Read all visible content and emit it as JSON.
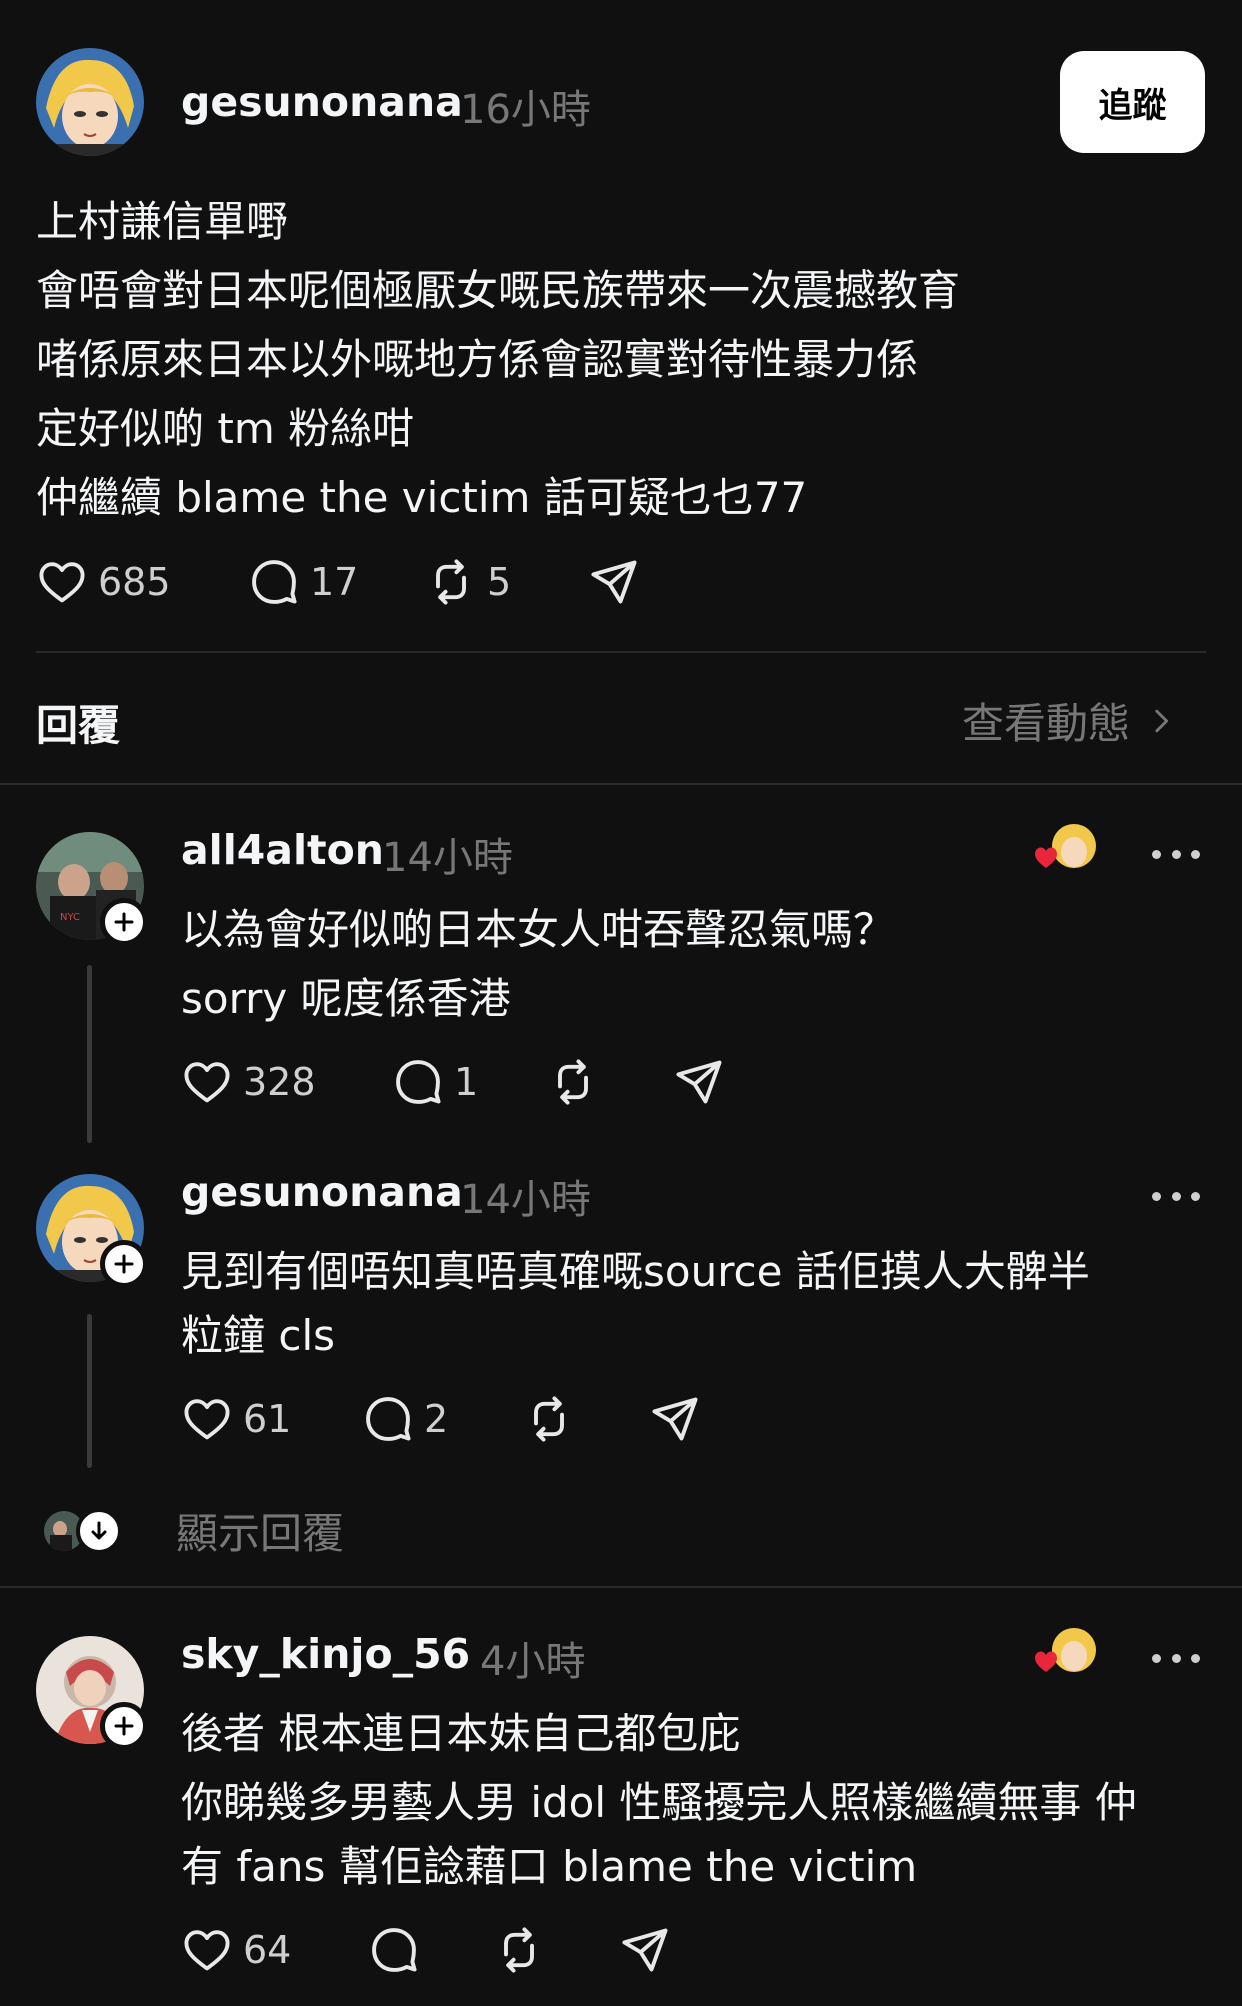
{
  "post": {
    "username": "gesunonana",
    "time": "16小時",
    "follow_label": "追蹤",
    "lines": [
      "上村謙信單嘢",
      "會唔會對日本呢個極厭女嘅民族帶來一次震撼教育",
      "啫係原來日本以外嘅地方係會認實對待性暴力係",
      "定好似啲 tm 粉絲咁",
      "仲繼續 blame the victim 話可疑乜乜77"
    ],
    "likes": "685",
    "comments": "17",
    "reposts": "5"
  },
  "replies_header": {
    "title": "回覆",
    "view_activity": "查看動態"
  },
  "replies": [
    {
      "username": "all4alton",
      "time": "14小時",
      "lines": [
        "以為會好似啲日本女人咁吞聲忍氣嗎？",
        "sorry 呢度係香港"
      ],
      "likes": "328",
      "comments": "1"
    },
    {
      "username": "gesunonana",
      "time": "14小時",
      "lines": [
        "見到有個唔知真唔真確嘅source 話佢摸人大髀半",
        "粒鐘 cls"
      ],
      "likes": "61",
      "comments": "2"
    },
    {
      "username": "sky_kinjo_56",
      "time": "4小時",
      "lines": [
        "後者 根本連日本妹自己都包庇",
        "你睇幾多男藝人男 idol 性騷擾完人照樣繼續無事 仲",
        "有 fans 幫佢諗藉口 blame the victim"
      ],
      "likes": "64"
    }
  ],
  "show_replies": "顯示回覆"
}
